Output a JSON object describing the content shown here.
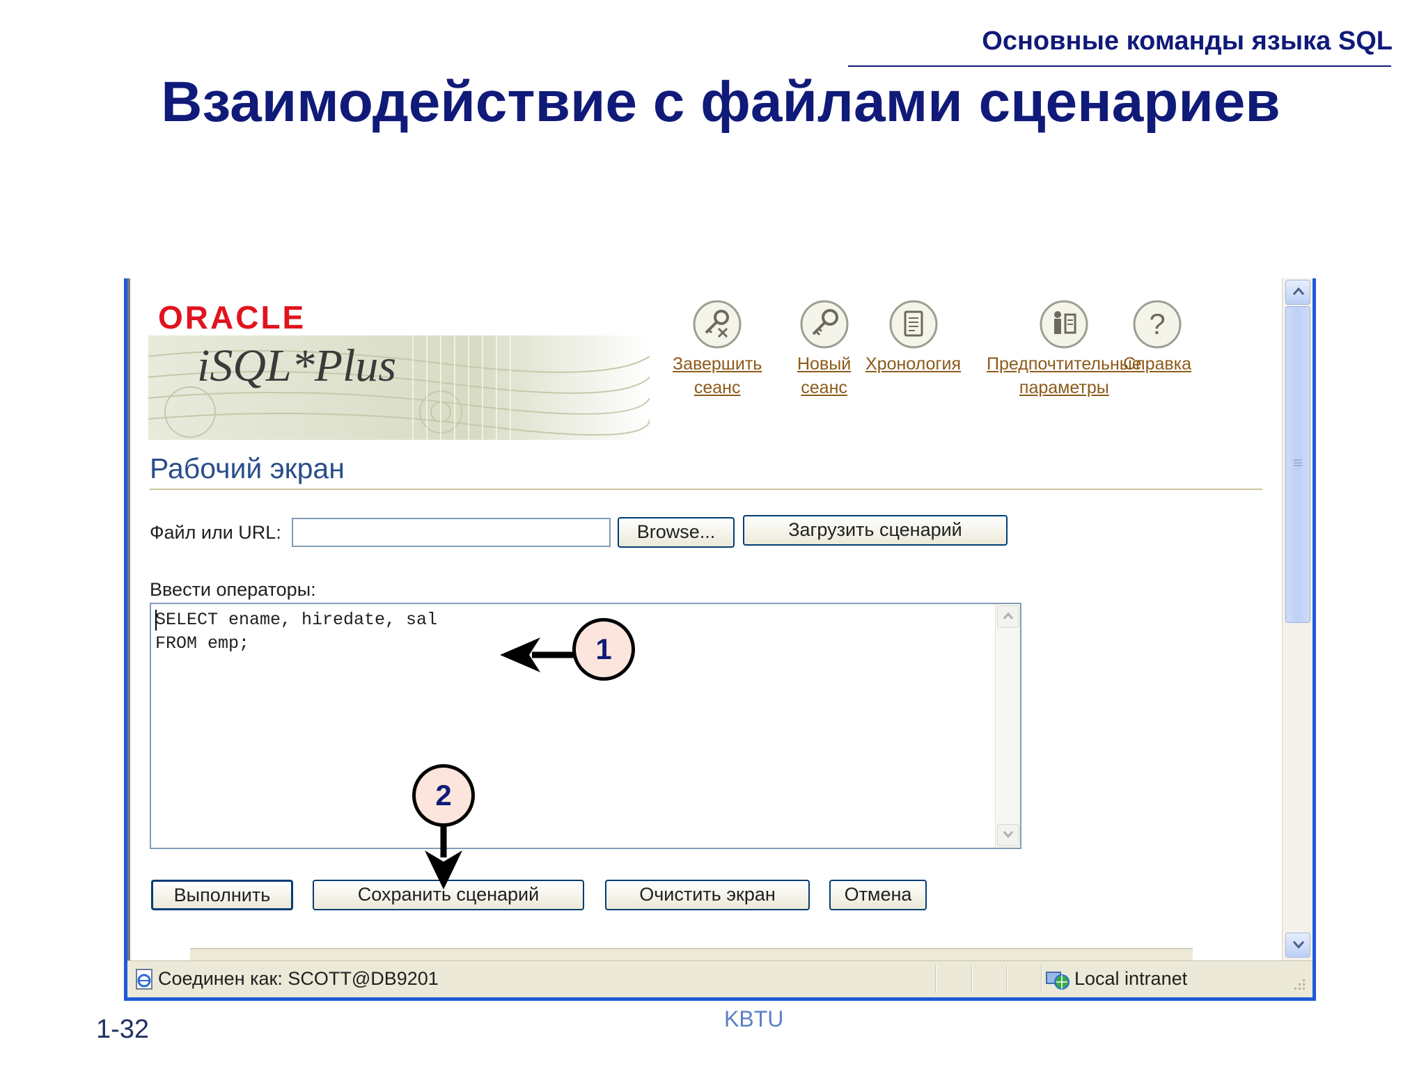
{
  "slide": {
    "subtitle": "Основные команды языка SQL",
    "title": "Взаимодействие с файлами сценариев",
    "number": "1-32",
    "footer": "KBTU"
  },
  "brand": {
    "logo": "ORACLE",
    "product": "iSQL*Plus"
  },
  "nav": {
    "items": [
      {
        "icon": "logout-key-icon",
        "line1": "Завершить",
        "line2": "сеанс"
      },
      {
        "icon": "key-icon",
        "line1": "Новый",
        "line2": "сеанс"
      },
      {
        "icon": "history-icon",
        "line1": "Хронология",
        "line2": ""
      },
      {
        "icon": "preferences-icon",
        "line1": "Предпочтительные",
        "line2": "параметры"
      },
      {
        "icon": "help-icon",
        "line1": "Справка",
        "line2": ""
      }
    ]
  },
  "workspace": {
    "title": "Рабочий экран",
    "file_label": "Файл или URL:",
    "file_value": "",
    "browse_label": "Browse...",
    "load_label": "Загрузить сценарий",
    "statements_label": "Ввести операторы:",
    "sql_text": "SELECT ename, hiredate, sal\nFROM emp;",
    "execute_label": "Выполнить",
    "save_label": "Сохранить сценарий",
    "clear_label": "Очистить экран",
    "cancel_label": "Отмена"
  },
  "status": {
    "connection": "Соединен как: SCOTT@DB9201",
    "zone": "Local intranet"
  },
  "callouts": [
    "1",
    "2"
  ],
  "colors": {
    "title": "#101a78",
    "oracle_red": "#e0141e",
    "link": "#8c5a1a",
    "window_border": "#1f5ad8"
  }
}
